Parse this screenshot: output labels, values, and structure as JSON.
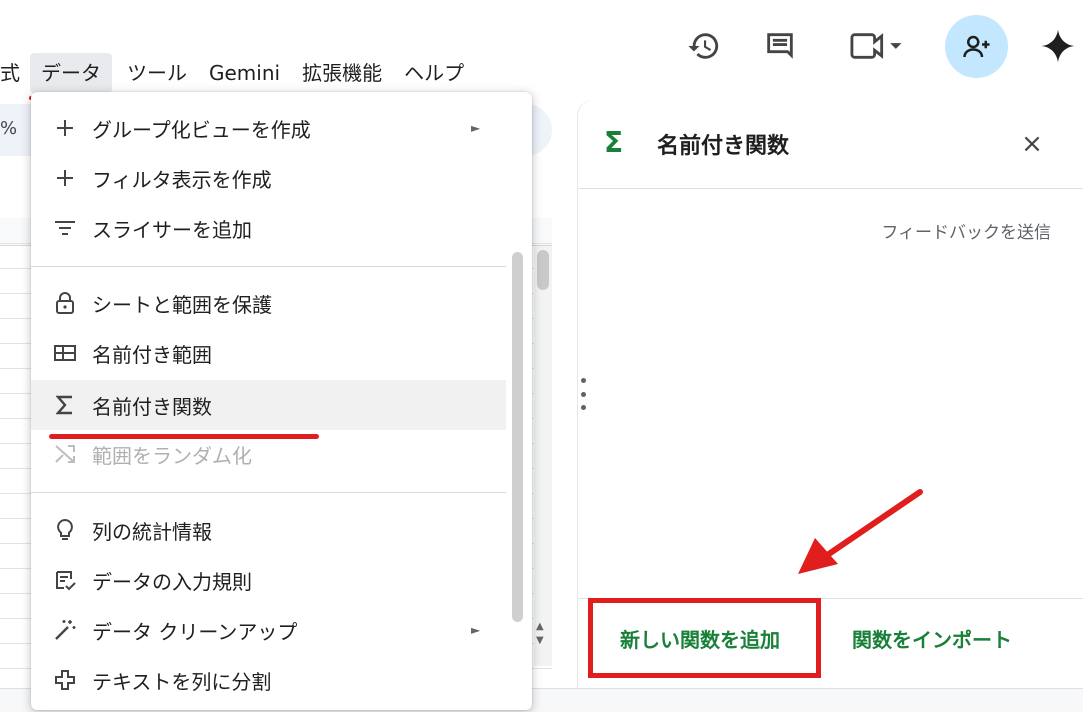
{
  "menubar": {
    "items": [
      "式",
      "データ",
      "ツール",
      "Gemini",
      "拡張機能",
      "ヘルプ"
    ]
  },
  "toolbar": {
    "percent": "%"
  },
  "dropdown": {
    "items": [
      {
        "label": "グループ化ビューを作成",
        "icon": "plus-icon",
        "submenu": true
      },
      {
        "label": "フィルタ表示を作成",
        "icon": "plus-icon"
      },
      {
        "label": "スライサーを追加",
        "icon": "filter-lines-icon"
      },
      {
        "label": "シートと範囲を保護",
        "icon": "lock-icon"
      },
      {
        "label": "名前付き範囲",
        "icon": "named-range-icon"
      },
      {
        "label": "名前付き関数",
        "icon": "sigma-icon",
        "highlighted": true
      },
      {
        "label": "範囲をランダム化",
        "icon": "shuffle-icon",
        "disabled": true
      },
      {
        "label": "列の統計情報",
        "icon": "lightbulb-icon"
      },
      {
        "label": "データの入力規則",
        "icon": "validation-icon"
      },
      {
        "label": "データ クリーンアップ",
        "icon": "magic-wand-icon",
        "submenu": true
      },
      {
        "label": "テキストを列に分割",
        "icon": "split-icon"
      }
    ],
    "submenu_arrow": "►"
  },
  "panel": {
    "title": "名前付き関数",
    "sigma": "Σ",
    "close": "×",
    "feedback": "フィードバックを送信",
    "add_button": "新しい関数を追加",
    "import_button": "関数をインポート"
  },
  "colors": {
    "accent_green": "#188038",
    "annotation_red": "#e01e1e",
    "share_bg": "#c2e7ff"
  }
}
